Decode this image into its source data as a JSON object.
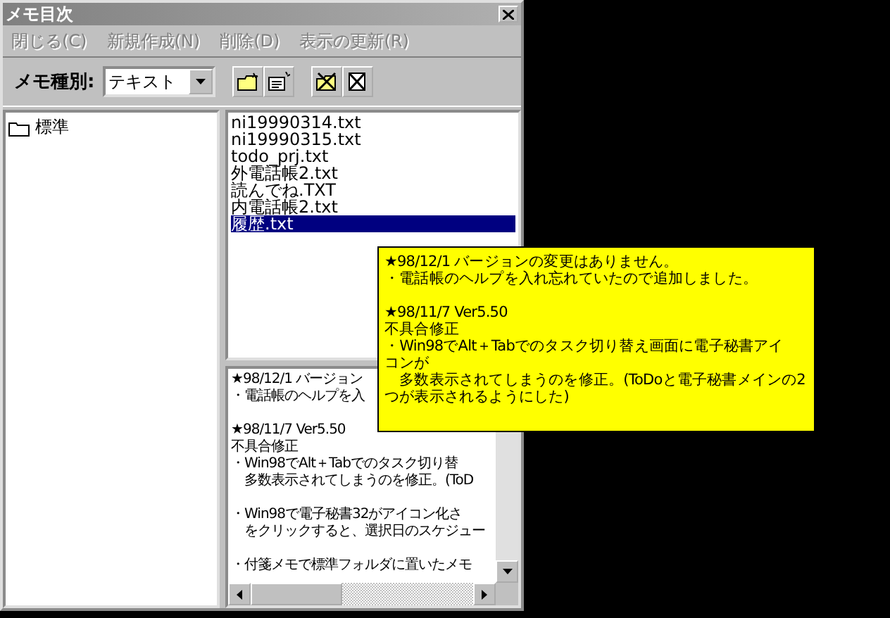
{
  "window": {
    "title": "メモ目次"
  },
  "menu": [
    {
      "label": "閉じる(C)",
      "disabled": true
    },
    {
      "label": "新規作成(N)",
      "disabled": true
    },
    {
      "label": "削除(D)",
      "disabled": true
    },
    {
      "label": "表示の更新(R)",
      "disabled": true
    }
  ],
  "toolbar": {
    "label": "メモ種別:",
    "memo_type": "テキスト"
  },
  "folders": [
    {
      "label": "標準",
      "selected": false
    }
  ],
  "files": [
    {
      "name": "ni19990314.txt",
      "selected": false
    },
    {
      "name": "ni19990315.txt",
      "selected": false
    },
    {
      "name": "todo_prj.txt",
      "selected": false
    },
    {
      "name": "外電話帳2.txt",
      "selected": false
    },
    {
      "name": "読んでね.TXT",
      "selected": false
    },
    {
      "name": "内電話帳2.txt",
      "selected": false
    },
    {
      "name": "履歴.txt",
      "selected": true
    }
  ],
  "preview": [
    [
      "★98/12/1 バージョン",
      "・電話帳のヘルプを入"
    ],
    [
      "★98/11/7 Ver5.50",
      "不具合修正",
      "・Win98でAlt＋Tabでのタスク切り替",
      "　多数表示されてしまうのを修正。(ToD"
    ],
    [
      "・Win98で電子秘書32がアイコン化さ",
      "　をクリックすると、選択日のスケジュー"
    ],
    [
      "・付箋メモで標準フォルダに置いたメモ"
    ]
  ],
  "tooltip": [
    [
      "★98/12/1 バージョンの変更はありません。",
      "・電話帳のヘルプを入れ忘れていたので追加しました。"
    ],
    [
      "★98/11/7 Ver5.50",
      "不具合修正",
      "・Win98でAlt＋Tabでのタスク切り替え画面に電子秘書アイ",
      "コンが",
      "　多数表示されてしまうのを修正。(ToDoと電子秘書メインの2",
      "つが表示されるようにした)"
    ]
  ]
}
